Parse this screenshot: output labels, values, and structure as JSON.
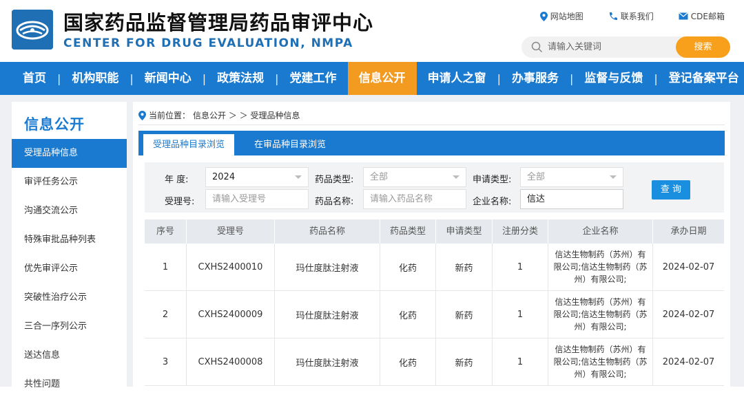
{
  "header": {
    "title_cn": "国家药品监督管理局药品审评中心",
    "title_en": "CENTER FOR DRUG EVALUATION, NMPA",
    "links": {
      "sitemap": "网站地图",
      "contact": "联系我们",
      "mail": "CDE邮箱"
    },
    "search": {
      "placeholder": "请输入关键词",
      "button": "搜索"
    }
  },
  "nav": {
    "items": [
      "首页",
      "机构职能",
      "新闻中心",
      "政策法规",
      "党建工作",
      "信息公开",
      "申请人之窗",
      "办事服务",
      "监督与反馈",
      "登记备案平台"
    ],
    "active": "信息公开"
  },
  "sidebar": {
    "title": "信息公开",
    "items": [
      "受理品种信息",
      "审评任务公示",
      "沟通交流公示",
      "特殊审批品种列表",
      "优先审评公示",
      "突破性治疗公示",
      "三合一序列公示",
      "送达信息",
      "共性问题"
    ]
  },
  "breadcrumb": {
    "prefix": "当前位置：",
    "path": "信息公开 ＞ ＞ 受理品种信息"
  },
  "tabs": {
    "active": "受理品种目录浏览",
    "inactive": "在审品种目录浏览"
  },
  "filter": {
    "year_label": "年  度:",
    "year_value": "2024",
    "drug_type_label": "药品类型:",
    "drug_type_value": "全部",
    "app_type_label": "申请类型:",
    "app_type_value": "全部",
    "accept_no_label": "受理号:",
    "accept_no_placeholder": "请输入受理号",
    "drug_name_label": "药品名称:",
    "drug_name_placeholder": "请输入药品名称",
    "company_label": "企业名称:",
    "company_value": "信达",
    "query_button": "查 询"
  },
  "table": {
    "headers": [
      "序号",
      "受理号",
      "药品名称",
      "药品类型",
      "申请类型",
      "注册分类",
      "企业名称",
      "承办日期"
    ],
    "rows": [
      {
        "no": "1",
        "accept_no": "CXHS2400010",
        "drug": "玛仕度肽注射液",
        "drug_type": "化药",
        "app_type": "新药",
        "reg_class": "1",
        "company": "信达生物制药（苏州）有限公司;信达生物制药（苏州）有限公司;",
        "date": "2024-02-07"
      },
      {
        "no": "2",
        "accept_no": "CXHS2400009",
        "drug": "玛仕度肽注射液",
        "drug_type": "化药",
        "app_type": "新药",
        "reg_class": "1",
        "company": "信达生物制药（苏州）有限公司;信达生物制药（苏州）有限公司;",
        "date": "2024-02-07"
      },
      {
        "no": "3",
        "accept_no": "CXHS2400008",
        "drug": "玛仕度肽注射液",
        "drug_type": "化药",
        "app_type": "新药",
        "reg_class": "1",
        "company": "信达生物制药（苏州）有限公司;信达生物制药（苏州）有限公司;",
        "date": "2024-02-07"
      }
    ]
  }
}
